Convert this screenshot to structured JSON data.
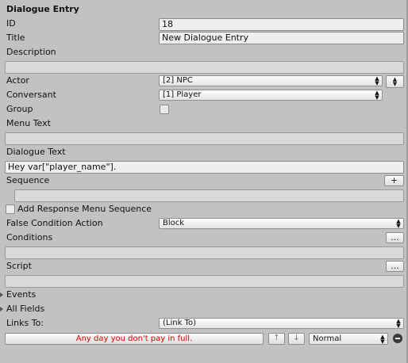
{
  "title": "Dialogue Entry",
  "fields": {
    "id_label": "ID",
    "id_value": "18",
    "title_label": "Title",
    "title_value": "New Dialogue Entry",
    "description_label": "Description",
    "description_value": "",
    "actor_label": "Actor",
    "actor_value": "[2] NPC",
    "conversant_label": "Conversant",
    "conversant_value": "[1] Player",
    "group_label": "Group",
    "group_checked": false,
    "menu_text_label": "Menu Text",
    "menu_text_value": "",
    "dialogue_text_label": "Dialogue Text",
    "dialogue_text_value": "Hey var[\"player_name\"].",
    "sequence_label": "Sequence",
    "sequence_add_label": "+",
    "sequence_value": "",
    "add_response_label": "Add Response Menu Sequence",
    "add_response_checked": false,
    "false_condition_label": "False Condition Action",
    "false_condition_value": "Block",
    "conditions_label": "Conditions",
    "conditions_button_label": "...",
    "conditions_value": "",
    "script_label": "Script",
    "script_button_label": "...",
    "script_value": "",
    "events_label": "Events",
    "all_fields_label": "All Fields",
    "links_to_label": "Links To:",
    "links_to_value": "(Link To)"
  },
  "footer": {
    "link_text": "Any day you don't pay in full.",
    "up_label": "↑",
    "down_label": "↓",
    "priority_value": "Normal"
  },
  "colors": {
    "background": "#c2c2c2",
    "warning_text": "#d40000"
  },
  "icons": {
    "actor_swap": "swap-icon",
    "fold": "foldout-arrow-icon",
    "delete": "minus-circle-icon"
  }
}
